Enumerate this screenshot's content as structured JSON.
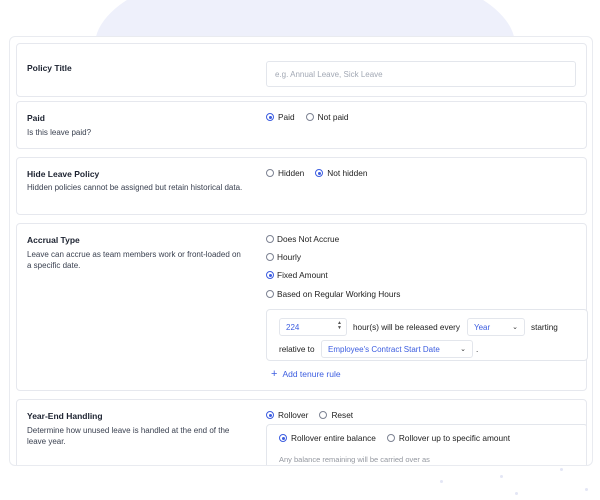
{
  "colors": {
    "accent": "#3c5de0",
    "border": "#e6e8ee",
    "blob": "#eef0fb"
  },
  "policy_title": {
    "label": "Policy Title",
    "placeholder": "e.g. Annual Leave, Sick Leave",
    "value": ""
  },
  "paid": {
    "label": "Paid",
    "description": "Is this leave paid?",
    "options": [
      {
        "label": "Paid",
        "selected": true
      },
      {
        "label": "Not paid",
        "selected": false
      }
    ]
  },
  "hide_policy": {
    "label": "Hide Leave Policy",
    "description": "Hidden policies cannot be assigned but retain historical data.",
    "options": [
      {
        "label": "Hidden",
        "selected": false
      },
      {
        "label": "Not hidden",
        "selected": true
      }
    ]
  },
  "accrual": {
    "label": "Accrual Type",
    "description": "Leave can accrue as team members work or front-loaded on a specific date.",
    "options": [
      {
        "label": "Does Not Accrue",
        "selected": false
      },
      {
        "label": "Hourly",
        "selected": false
      },
      {
        "label": "Fixed Amount",
        "selected": true
      },
      {
        "label": "Based on Regular Working Hours",
        "selected": false
      }
    ],
    "hours_value": "224",
    "release_text": "hour(s) will be released every",
    "period_value": "Year",
    "starting_text": "starting",
    "relative_text": "relative to",
    "relative_value": "Employee's Contract Start Date",
    "period_end": ".",
    "add_tenure_label": "Add tenure rule"
  },
  "year_end": {
    "label": "Year-End Handling",
    "description": "Determine how unused leave is handled at the end of the leave year.",
    "options": [
      {
        "label": "Rollover",
        "selected": true
      },
      {
        "label": "Reset",
        "selected": false
      }
    ],
    "sub_options": [
      {
        "label": "Rollover entire balance",
        "selected": true
      },
      {
        "label": "Rollover up to specific amount",
        "selected": false
      }
    ],
    "note": "Any balance remaining will be carried over as"
  }
}
